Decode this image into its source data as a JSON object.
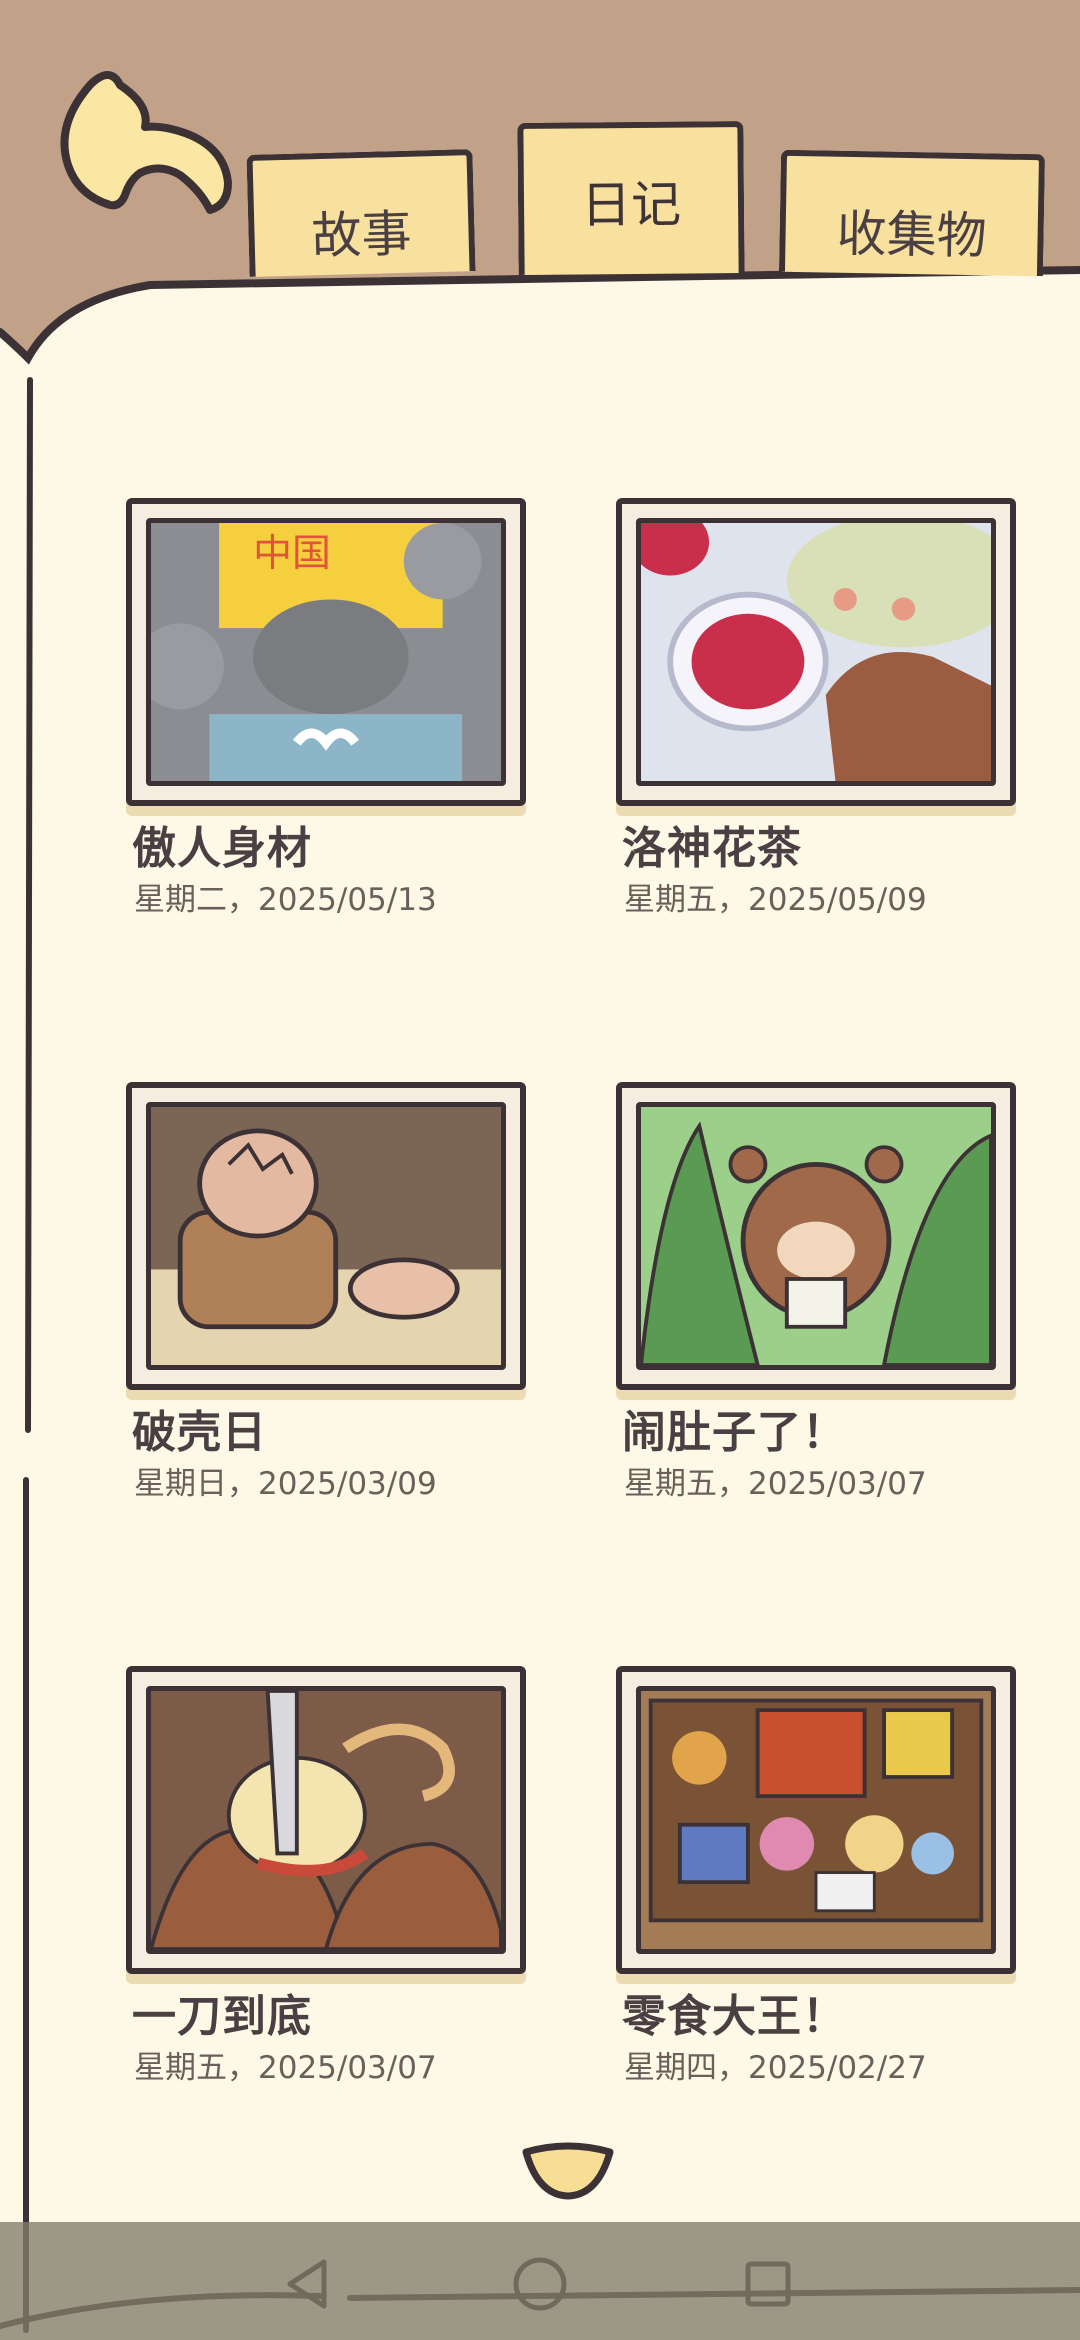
{
  "tabs": [
    {
      "label": "故事",
      "active": false
    },
    {
      "label": "日记",
      "active": true
    },
    {
      "label": "收集物",
      "active": false
    }
  ],
  "diary": [
    {
      "title": "傲人身材",
      "date": "星期二，2025/05/13"
    },
    {
      "title": "洛神花茶",
      "date": "星期五，2025/05/09"
    },
    {
      "title": "破壳日",
      "date": "星期日，2025/03/09"
    },
    {
      "title": "闹肚子了！",
      "date": "星期五，2025/03/07"
    },
    {
      "title": "一刀到底",
      "date": "星期五，2025/03/07"
    },
    {
      "title": "零食大王！",
      "date": "星期四，2025/02/27"
    }
  ],
  "icons": {
    "back": "back-arrow-icon",
    "more": "chevron-down-icon",
    "nav_back": "triangle-back-icon",
    "nav_home": "circle-home-icon",
    "nav_recent": "square-recent-icon"
  },
  "colors": {
    "background": "#c1a289",
    "page": "#fdf9e6",
    "tab": "#f8e09e",
    "ink": "#3c3236"
  }
}
